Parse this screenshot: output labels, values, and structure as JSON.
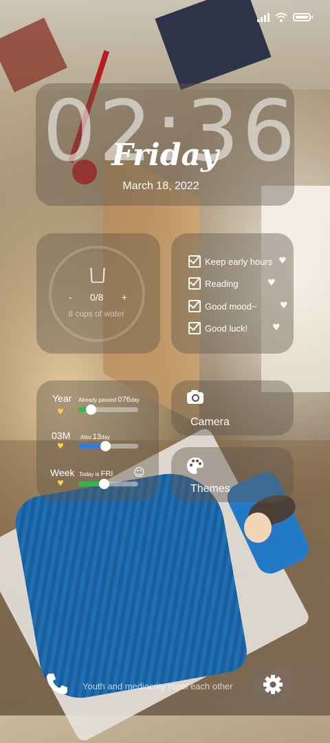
{
  "clock": {
    "time": "02:36",
    "day": "Friday",
    "date": "March 18, 2022"
  },
  "water": {
    "minus": "-",
    "count": "0/8",
    "plus": "+",
    "subtitle": "8 cups of water"
  },
  "todo": {
    "items": [
      {
        "label": "Keep early hours"
      },
      {
        "label": "Reading"
      },
      {
        "label": "Good mood~"
      },
      {
        "label": "Good luck!"
      }
    ]
  },
  "progress": {
    "year": {
      "label": "Year",
      "caption": "Already passed",
      "value": "076",
      "unit": "day",
      "fraction": 0.21,
      "color": "#2fb94b"
    },
    "month": {
      "label": "03M",
      "caption": "Also",
      "value": "13",
      "unit": "day",
      "fraction": 0.45,
      "color": "#2d7be5"
    },
    "week": {
      "label": "Week",
      "caption": "Today is",
      "value": "FRI",
      "fraction": 0.42,
      "color": "#2fb94b"
    },
    "smile": "☺"
  },
  "apps": {
    "camera": "Camera",
    "themes": "Themes"
  },
  "bottom": {
    "slogan": "Youth and mediocrity repel each other"
  },
  "icons": [
    "signal-icon",
    "wifi-icon",
    "battery-icon",
    "cup-icon",
    "checkbox-icon",
    "heart-icon",
    "camera-icon",
    "palette-icon",
    "phone-icon",
    "settings-icon"
  ]
}
